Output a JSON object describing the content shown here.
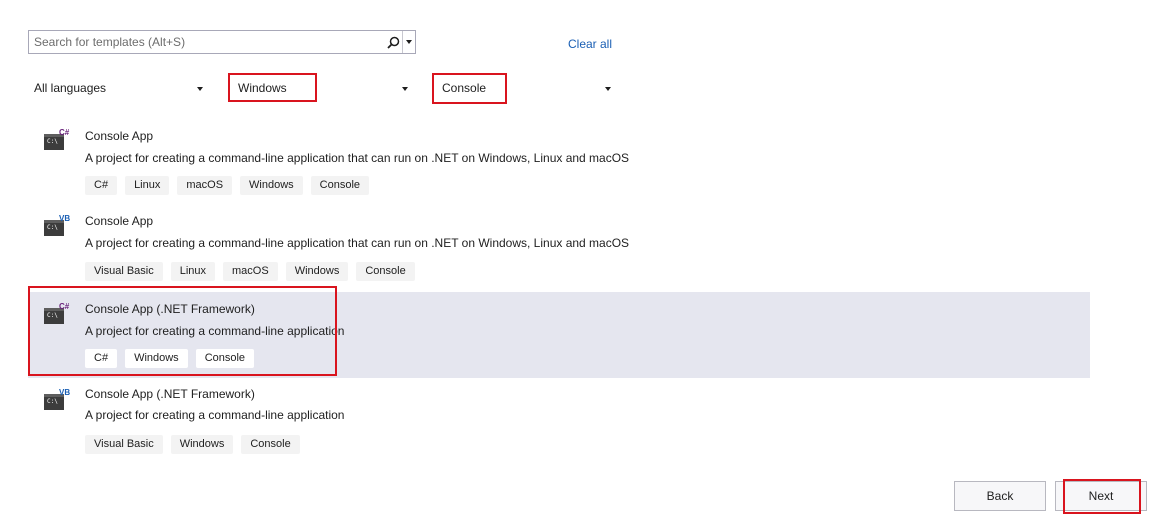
{
  "search": {
    "placeholder": "Search for templates (Alt+S)"
  },
  "clear_all_label": "Clear all",
  "filters": {
    "language": "All languages",
    "platform": "Windows",
    "project_type": "Console"
  },
  "templates": [
    {
      "icon_badge": "C#",
      "name": "Console App",
      "description": "A project for creating a command-line application that can run on .NET on Windows, Linux and macOS",
      "tags": [
        "C#",
        "Linux",
        "macOS",
        "Windows",
        "Console"
      ]
    },
    {
      "icon_badge": "VB",
      "name": "Console App",
      "description": "A project for creating a command-line application that can run on .NET on Windows, Linux and macOS",
      "tags": [
        "Visual Basic",
        "Linux",
        "macOS",
        "Windows",
        "Console"
      ]
    },
    {
      "icon_badge": "C#",
      "name": "Console App (.NET Framework)",
      "description": "A project for creating a command-line application",
      "tags": [
        "C#",
        "Windows",
        "Console"
      ],
      "selected": true
    },
    {
      "icon_badge": "VB",
      "name": "Console App (.NET Framework)",
      "description": "A project for creating a command-line application",
      "tags": [
        "Visual Basic",
        "Windows",
        "Console"
      ]
    }
  ],
  "icon_text": "C:\\",
  "buttons": {
    "back": "Back",
    "next": "Next"
  },
  "colors": {
    "highlight_box": "#d9141e",
    "selected_row": "#e5e6ef",
    "link": "#1a5fb4"
  }
}
